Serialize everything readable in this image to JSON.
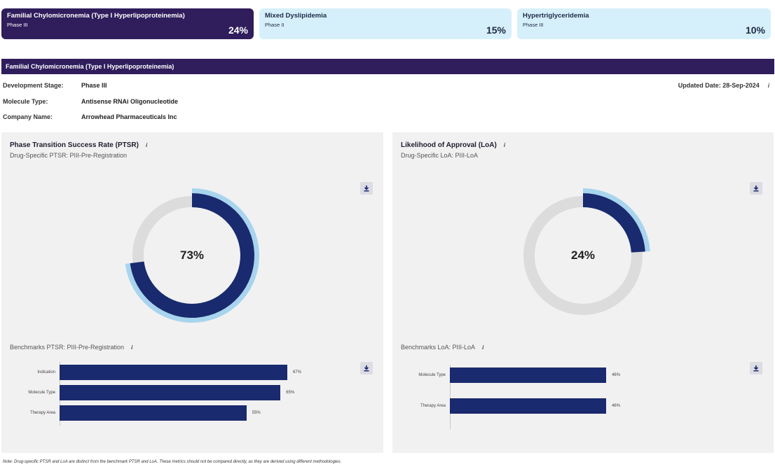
{
  "top_cards": [
    {
      "name": "Familial Chylomicronemia (Type I Hyperlipoproteinemia)",
      "phase": "Phase III",
      "pct": "24%"
    },
    {
      "name": "Mixed Dyslipidemia",
      "phase": "Phase II",
      "pct": "15%"
    },
    {
      "name": "Hypertriglyceridemia",
      "phase": "Phase III",
      "pct": "10%"
    }
  ],
  "banner": {
    "title": "Familial Chylomicronemia (Type I Hyperlipoproteinemia)"
  },
  "details": {
    "stage_label": "Development Stage:",
    "stage_value": "Phase III",
    "molecule_label": "Molecule Type:",
    "molecule_value": "Antisense RNAi Oligonucleotide",
    "company_label": "Company Name:",
    "company_value": "Arrowhead Pharmaceuticals Inc",
    "updated": "Updated Date: 28-Sep-2024"
  },
  "ptsr": {
    "title": "Phase Transition Success Rate (PTSR)",
    "subtitle": "Drug-Specific PTSR: PIII-Pre-Registration",
    "value": 73,
    "value_label": "73%",
    "bench_title": "Benchmarks PTSR: PIII-Pre-Registration"
  },
  "loa": {
    "title": "Likelihood of Approval (LoA)",
    "subtitle": "Drug-Specific LoA: PIII-LoA",
    "value": 24,
    "value_label": "24%",
    "bench_title": "Benchmarks LoA: PIII-LoA"
  },
  "icons": {
    "info": "info-icon",
    "download": "download-icon"
  },
  "colors": {
    "navy": "#1a2a6e",
    "light_blue": "#a8d4ee",
    "track": "#dcdcdc",
    "purple": "#2f1d5c",
    "card_light": "#d6f0fb"
  },
  "chart_data": [
    {
      "type": "bar",
      "orientation": "horizontal",
      "categories": [
        "Indication",
        "Molecule Type",
        "Therapy Area"
      ],
      "values": [
        67,
        65,
        55
      ],
      "value_labels": [
        "67%",
        "65%",
        "55%"
      ]
    },
    {
      "type": "bar",
      "orientation": "horizontal",
      "categories": [
        "Molecule Type",
        "Therapy Area"
      ],
      "values": [
        46,
        46
      ],
      "value_labels": [
        "46%",
        "46%"
      ]
    }
  ],
  "note": "Note: Drug-specific PTSR and LoA are distinct from the benchmark PTSR and LoA. These metrics should not be compared directly, as they are derived using different methodologies."
}
